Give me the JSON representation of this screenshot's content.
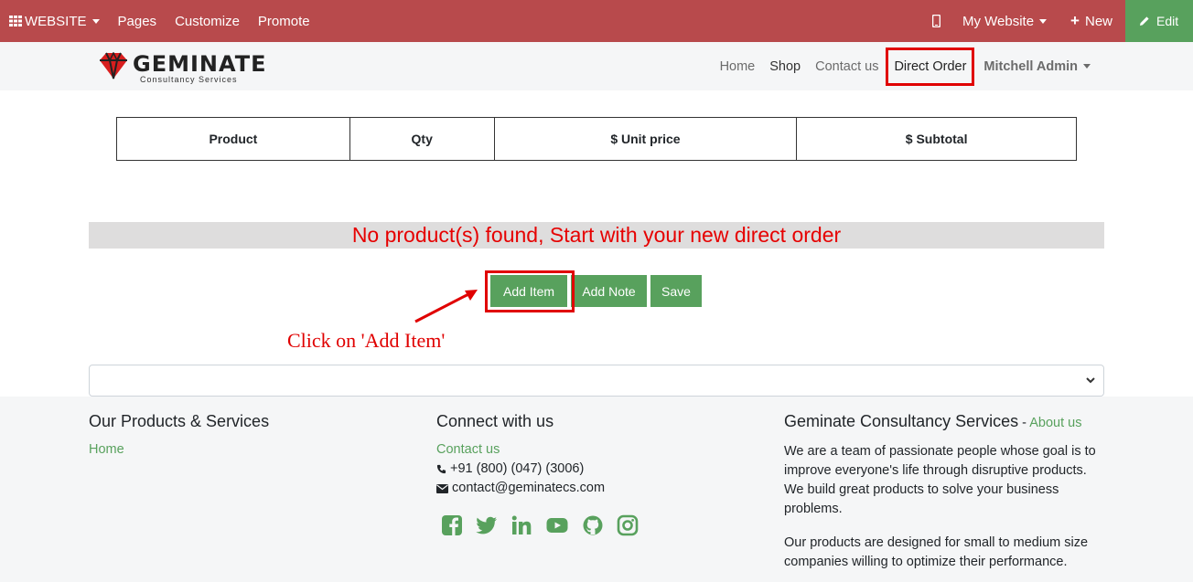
{
  "topbar": {
    "website_label": "WEBSITE",
    "pages": "Pages",
    "customize": "Customize",
    "promote": "Promote",
    "my_website": "My Website",
    "new": "New",
    "edit": "Edit"
  },
  "header": {
    "logo_text": "GEMINATE",
    "logo_sub": "Consultancy Services",
    "nav": {
      "home": "Home",
      "shop": "Shop",
      "contact": "Contact us",
      "direct_order": "Direct Order",
      "user": "Mitchell Admin"
    }
  },
  "order_table": {
    "headers": [
      "Product",
      "Qty",
      "$ Unit price",
      "$ Subtotal"
    ]
  },
  "banner_text": "No product(s) found, Start with your new direct order",
  "buttons": {
    "add_item": "Add Item",
    "add_note": "Add Note",
    "save": "Save"
  },
  "annotation": "Click on 'Add Item'",
  "footer": {
    "col1": {
      "heading": "Our Products & Services",
      "link": "Home"
    },
    "col2": {
      "heading": "Connect with us",
      "link": "Contact us",
      "phone": "+91 (800) (047) (3006)",
      "email": "contact@geminatecs.com"
    },
    "col3": {
      "heading": "Geminate Consultancy Services",
      "separator": " - ",
      "about": "About us",
      "para1": "We are a team of passionate people whose goal is to improve everyone's life through disruptive products. We build great products to solve your business problems.",
      "para2": "Our products are designed for small to medium size companies willing to optimize their performance."
    },
    "social_icons": [
      "facebook-icon",
      "twitter-icon",
      "linkedin-icon",
      "youtube-icon",
      "github-icon",
      "instagram-icon"
    ]
  },
  "colors": {
    "topbar": "#b84a4c",
    "accent_green": "#58a15d",
    "highlight_red": "#e00000"
  }
}
